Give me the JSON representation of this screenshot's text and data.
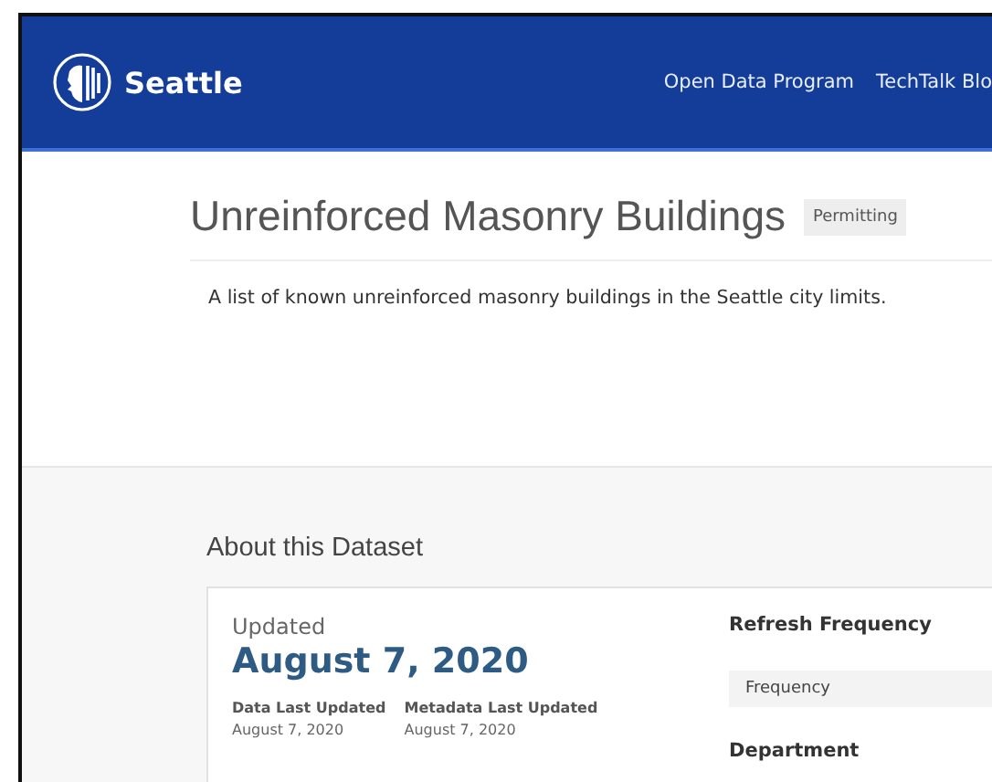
{
  "header": {
    "brand": "Seattle",
    "nav": [
      {
        "label": "Open Data Program"
      },
      {
        "label": "TechTalk Blo"
      }
    ]
  },
  "dataset": {
    "title": "Unreinforced Masonry Buildings",
    "tag": "Permitting",
    "description": "A list of known unreinforced masonry buildings in the Seattle city limits."
  },
  "about": {
    "heading": "About this Dataset",
    "updated_label": "Updated",
    "updated_date": "August 7, 2020",
    "details": [
      {
        "label": "Data Last Updated",
        "value": "August 7, 2020"
      },
      {
        "label": "Metadata Last Updated",
        "value": "August 7, 2020"
      }
    ],
    "refresh_label": "Refresh Frequency",
    "frequency_row": "Frequency",
    "department_label": "Department"
  }
}
